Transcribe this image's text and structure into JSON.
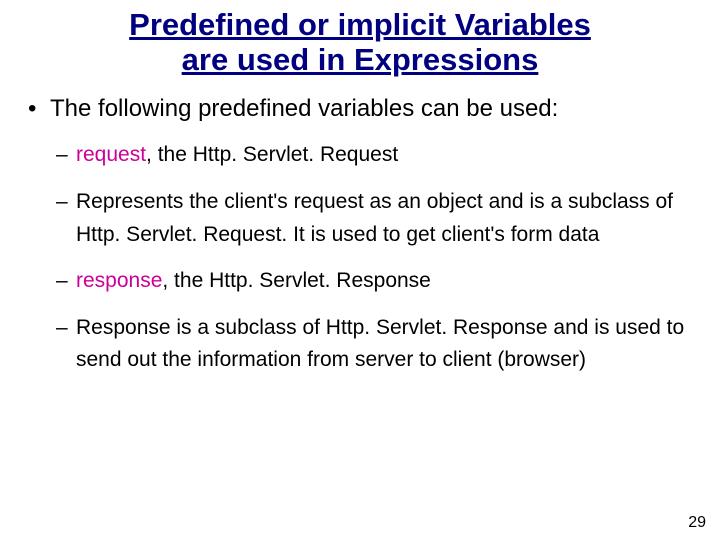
{
  "title_line1": "Predefined or implicit Variables",
  "title_line2": "are used in Expressions",
  "l1_text": "The following predefined variables can be used:",
  "b1_kw": "request",
  "b1_rest": ", the Http. Servlet. Request",
  "b2": "Represents the client's request as an object and is a subclass of Http. Servlet. Request. It is used to get client's form data",
  "b3_kw": "response",
  "b3_rest": ", the Http. Servlet. Response",
  "b4": "Response is a subclass of Http. Servlet. Response and is used to send out the information from server to client (browser)",
  "page_number": "29"
}
